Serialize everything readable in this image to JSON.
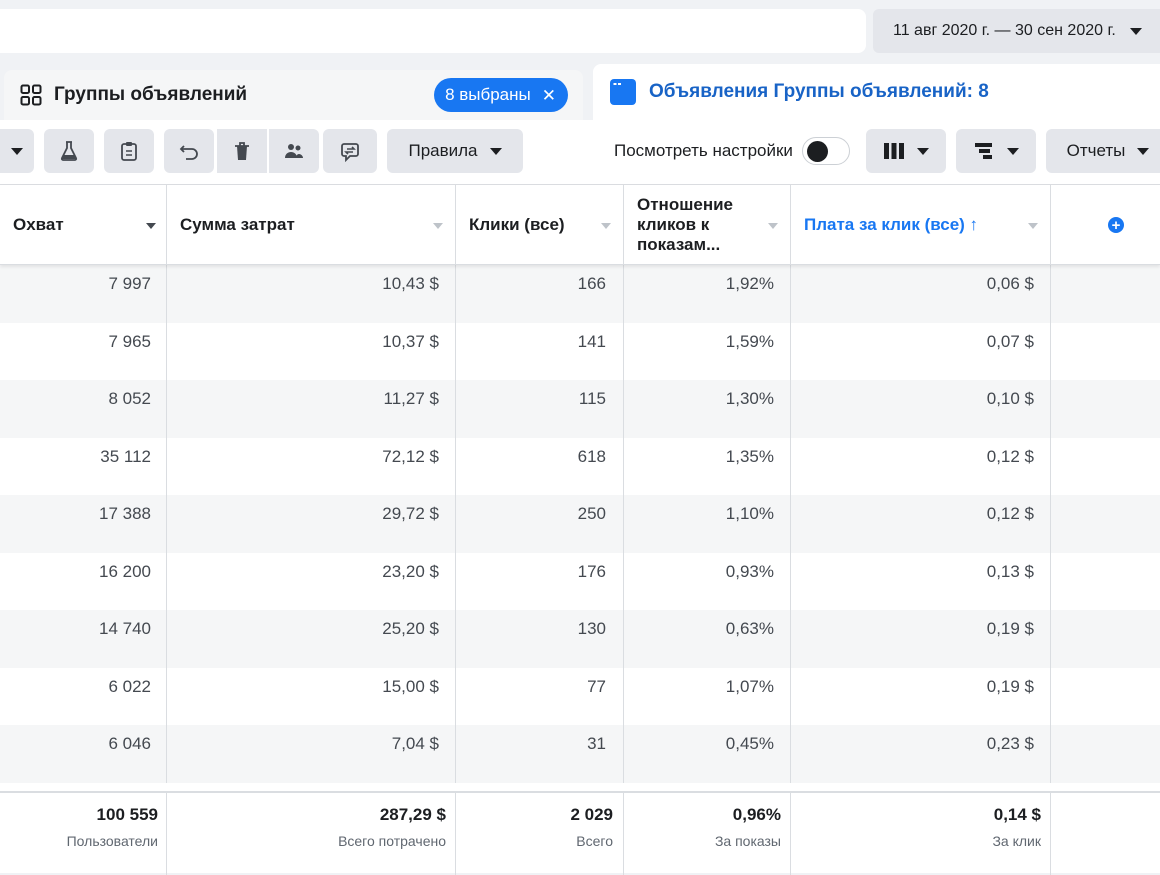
{
  "date_range": "11 авг 2020 г. — 30 сен 2020 г.",
  "tabs": {
    "adsets_label": "Группы объявлений",
    "selected_pill": "8 выбраны",
    "ads_label": "Объявления Группы объявлений: 8"
  },
  "toolbar": {
    "rules_label": "Правила",
    "view_settings_label": "Посмотреть настройки",
    "reports_label": "Отчеты"
  },
  "columns": [
    "Охват",
    "Сумма затрат",
    "Клики (все)",
    "Отношение кликов к показам...",
    "Плата за клик (все) ↑"
  ],
  "rows": [
    [
      "7 997",
      "10,43 $",
      "166",
      "1,92%",
      "0,06 $"
    ],
    [
      "7 965",
      "10,37 $",
      "141",
      "1,59%",
      "0,07 $"
    ],
    [
      "8 052",
      "11,27 $",
      "115",
      "1,30%",
      "0,10 $"
    ],
    [
      "35 112",
      "72,12 $",
      "618",
      "1,35%",
      "0,12 $"
    ],
    [
      "17 388",
      "29,72 $",
      "250",
      "1,10%",
      "0,12 $"
    ],
    [
      "16 200",
      "23,20 $",
      "176",
      "0,93%",
      "0,13 $"
    ],
    [
      "14 740",
      "25,20 $",
      "130",
      "0,63%",
      "0,19 $"
    ],
    [
      "6 022",
      "15,00 $",
      "77",
      "1,07%",
      "0,19 $"
    ],
    [
      "6 046",
      "7,04 $",
      "31",
      "0,45%",
      "0,23 $"
    ]
  ],
  "totals": [
    {
      "value": "100 559",
      "label": "Пользователи"
    },
    {
      "value": "287,29 $",
      "label": "Всего потрачено"
    },
    {
      "value": "2 029",
      "label": "Всего"
    },
    {
      "value": "0,96%",
      "label": "За показы"
    },
    {
      "value": "0,14 $",
      "label": "За клик"
    }
  ],
  "colors": {
    "accent": "#1877f2",
    "row_shade": "#f5f6f7"
  }
}
